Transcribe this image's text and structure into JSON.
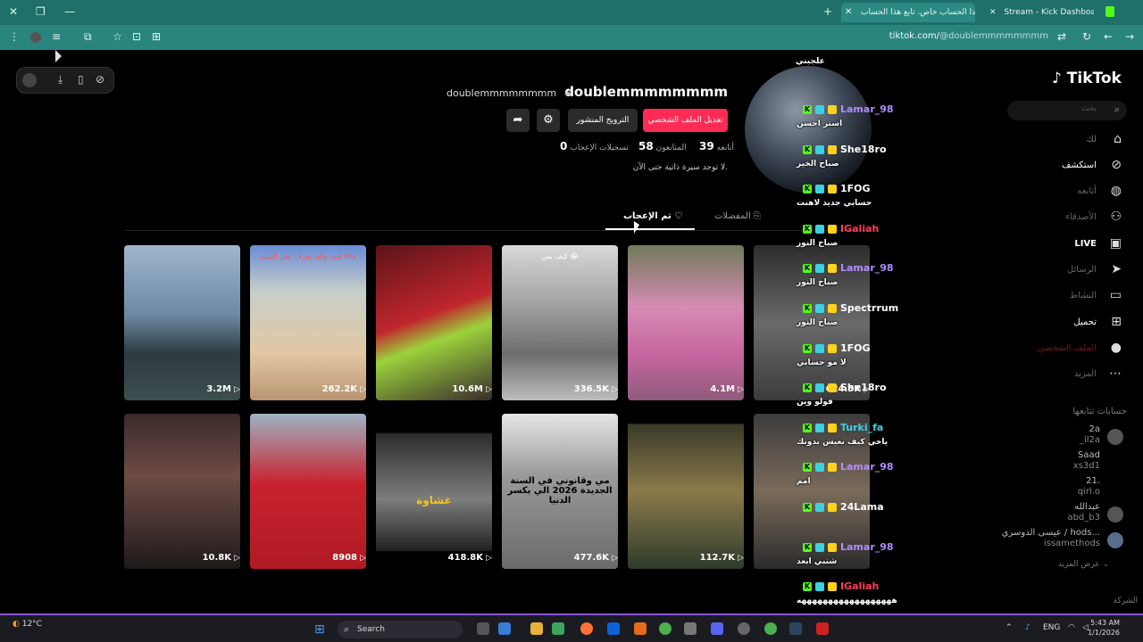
{
  "browser": {
    "tabs": [
      {
        "label": "هذا الحساب خاص. تابع هذا الحساب",
        "active": true
      },
      {
        "label": "Stream - Kick Dashboard",
        "active": false
      }
    ],
    "url_host": "tiktok.com/",
    "url_path": "@doublemmmmmmmm"
  },
  "sidebar": {
    "logo": "TikTok",
    "search_placeholder": "بحث",
    "items": [
      {
        "label": "لك",
        "icon": "home-icon"
      },
      {
        "label": "استكشف",
        "icon": "compass-icon"
      },
      {
        "label": "أتابعه",
        "icon": "following-icon"
      },
      {
        "label": "الأصدقاء",
        "icon": "friends-icon"
      },
      {
        "label": "LIVE",
        "icon": "live-icon"
      },
      {
        "label": "الرسائل",
        "icon": "messages-icon"
      },
      {
        "label": "النشاط",
        "icon": "activity-icon"
      },
      {
        "label": "تحميل",
        "icon": "upload-icon"
      },
      {
        "label": "الملف الشخصي",
        "icon": "profile-icon"
      },
      {
        "label": "المزيد",
        "icon": "more-icon"
      }
    ],
    "following_header": "حسابات تتابعها",
    "following": [
      {
        "name": "2a",
        "handle": "_il2a"
      },
      {
        "name": "Saad",
        "handle": "xs3d1"
      },
      {
        "name": "21.",
        "handle": "qirl.o"
      },
      {
        "name": "عبدالله",
        "handle": "abd_b3"
      },
      {
        "name": "عيسى الدوسري / hods...",
        "handle": "issamethods"
      }
    ],
    "see_more": "عرض المزيد",
    "company": "الشركة"
  },
  "profile": {
    "username": "doublemmmmmmmm",
    "nickname": "doublemmmmmmmm",
    "edit_button": "تعديل الملف الشخصي",
    "promote_button": "الترويج المنشور",
    "stats": [
      {
        "label": "أتابعه",
        "value": "39"
      },
      {
        "label": "المتابعون",
        "value": "58"
      },
      {
        "label": "تسجيلات الإعجاب",
        "value": "0"
      }
    ],
    "bio": "لا توجد سيرة ذاتية حتى الآن.",
    "tabs": {
      "favorites": "المفضلات",
      "liked": "تم الإعجاب"
    }
  },
  "videos": [
    {
      "views": "3.2M",
      "caption": ""
    },
    {
      "views": "262.2K",
      "caption": "قيت واحد يعزف على البنيان Pov"
    },
    {
      "views": "10.6M",
      "caption": ""
    },
    {
      "views": "336.5K",
      "caption": "كيف بس 😂"
    },
    {
      "views": "4.1M",
      "caption": ""
    },
    {
      "views": "624.5K",
      "caption": ""
    },
    {
      "views": "10.8K",
      "caption": ""
    },
    {
      "views": "8908",
      "caption": ""
    },
    {
      "views": "418.8K",
      "caption": "غشاوة"
    },
    {
      "views": "477.6K",
      "caption": "مي وقانوني في السنة الجديدة 2026 الي يكسر الدنيا"
    },
    {
      "views": "112.7K",
      "caption": ""
    },
    {
      "views": "",
      "caption": ""
    }
  ],
  "chat": {
    "top_text": "علجبني",
    "messages": [
      {
        "user": "Lamar_98",
        "color": "#b18cff",
        "text": "استر احسن"
      },
      {
        "user": "She18ro",
        "color": "#ffffff",
        "text": "صباح الخير"
      },
      {
        "user": "1FOG",
        "color": "#ffffff",
        "text": "حسابي جديد لاهنت"
      },
      {
        "user": "IGaliah",
        "color": "#ff3b5c",
        "text": "صباح النور"
      },
      {
        "user": "Lamar_98",
        "color": "#b18cff",
        "text": "صباح النور"
      },
      {
        "user": "Spectrrum",
        "color": "#ffffff",
        "text": "صباح النور"
      },
      {
        "user": "1FOG",
        "color": "#ffffff",
        "text": "لا مو حسابي"
      },
      {
        "user": "She18ro",
        "color": "#ffffff",
        "text": "فولو وين"
      },
      {
        "user": "Turki_fa",
        "color": "#3ad1e2",
        "text": "ياخي كيف نعيش بدونك"
      },
      {
        "user": "Lamar_98",
        "color": "#b18cff",
        "text": "امم"
      },
      {
        "user": "24Lama",
        "color": "#ffffff",
        "text": ""
      },
      {
        "user": "Lamar_98",
        "color": "#b18cff",
        "text": "شتبي ابعد"
      },
      {
        "user": "IGaliah",
        "color": "#ff3b5c",
        "text": "ههههههههههههههههههه"
      }
    ]
  },
  "taskbar": {
    "temp": "12°C",
    "search": "Search",
    "lang": "ENG",
    "time": "5:43 AM",
    "date": "1/1/2026"
  }
}
